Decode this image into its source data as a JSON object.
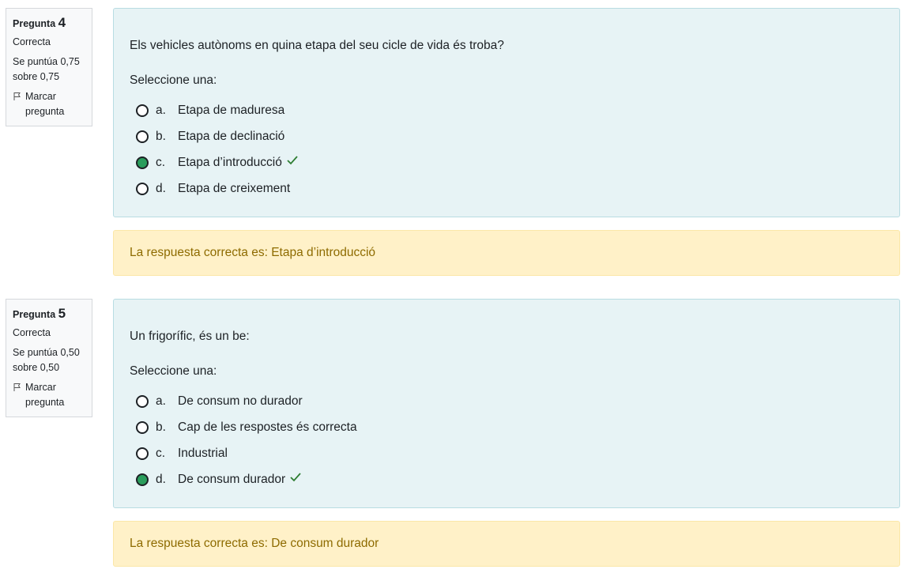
{
  "questions": [
    {
      "label": "Pregunta",
      "number": "4",
      "state": "Correcta",
      "grade": "Se puntúa 0,75 sobre 0,75",
      "flag_label": "Marcar pregunta",
      "text": "Els vehicles autònoms en quina etapa del seu cicle de vida és troba?",
      "prompt": "Seleccione una:",
      "options": [
        {
          "letter": "a.",
          "text": "Etapa de maduresa",
          "selected": false
        },
        {
          "letter": "b.",
          "text": "Etapa de declinació",
          "selected": false
        },
        {
          "letter": "c.",
          "text": "Etapa d’introducció",
          "selected": true
        },
        {
          "letter": "d.",
          "text": "Etapa de creixement",
          "selected": false
        }
      ],
      "feedback": "La respuesta correcta es: Etapa d’introducció"
    },
    {
      "label": "Pregunta",
      "number": "5",
      "state": "Correcta",
      "grade": "Se puntúa 0,50 sobre 0,50",
      "flag_label": "Marcar pregunta",
      "text": "Un frigorífic, és un be:",
      "prompt": "Seleccione una:",
      "options": [
        {
          "letter": "a.",
          "text": "De consum no durador",
          "selected": false
        },
        {
          "letter": "b.",
          "text": "Cap de les respostes és correcta",
          "selected": false
        },
        {
          "letter": "c.",
          "text": "Industrial",
          "selected": false
        },
        {
          "letter": "d.",
          "text": "De consum durador",
          "selected": true
        }
      ],
      "feedback": "La respuesta correcta es: De consum durador"
    }
  ],
  "colors": {
    "selected_radio": "#2a9d5c",
    "check": "#2e7d32",
    "question_bg": "#e7f3f5",
    "feedback_bg": "#fff1c8",
    "feedback_text": "#8e6b00"
  },
  "icons": {
    "flag": "flag-icon",
    "correct": "check-icon"
  }
}
